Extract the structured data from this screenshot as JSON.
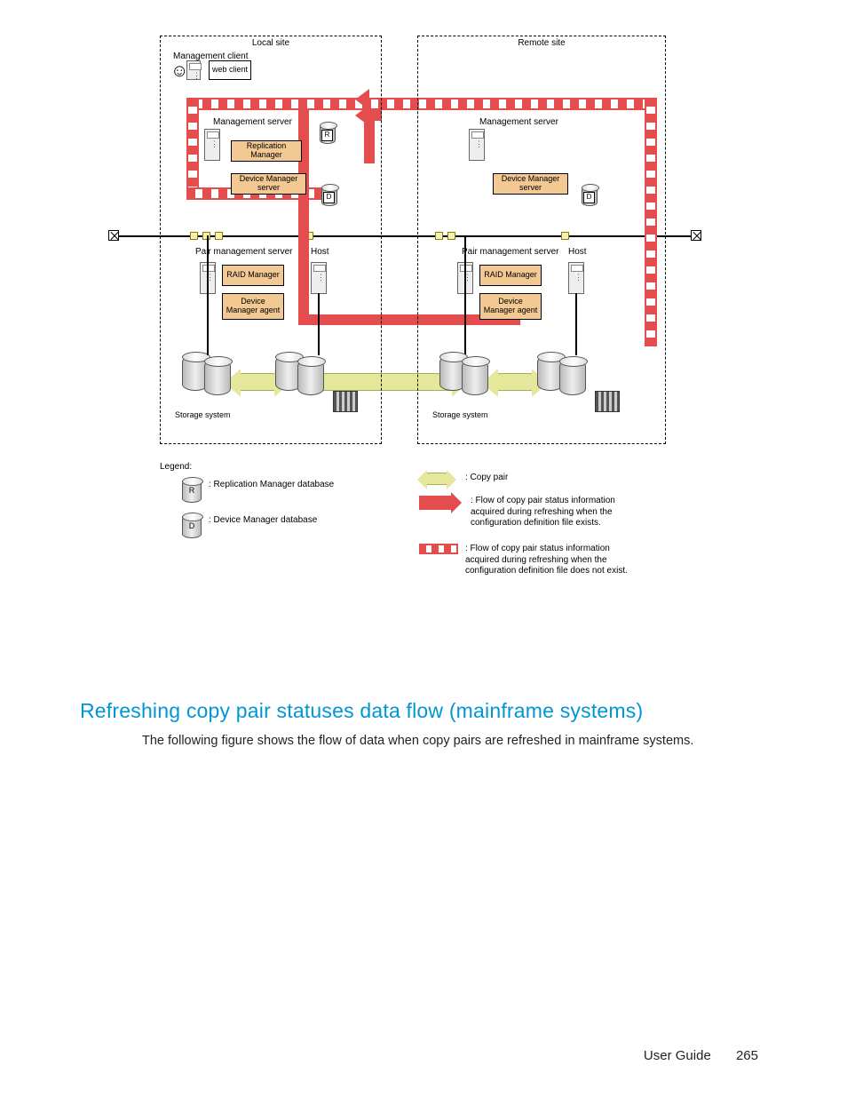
{
  "diagram": {
    "local_site_label": "Local site",
    "remote_site_label": "Remote site",
    "management_client_label": "Management client",
    "web_client_label": "web client",
    "management_server_label_local": "Management server",
    "management_server_label_remote": "Management server",
    "replication_manager_label": "Replication Manager",
    "device_manager_server_label": "Device Manager server",
    "pair_management_server_label": "Pair management server",
    "host_label": "Host",
    "raid_manager_label": "RAID Manager",
    "device_manager_agent_label": "Device Manager agent",
    "storage_system_label": "Storage system",
    "cyl_R": "R",
    "cyl_D": "D"
  },
  "legend": {
    "title": "Legend:",
    "replication_db": ": Replication Manager database",
    "device_db": ": Device Manager database",
    "copy_pair": ": Copy pair",
    "flow_solid": ": Flow of copy pair status information acquired during refreshing when the configuration definition file exists.",
    "flow_dash": ": Flow of copy pair status information acquired during refreshing when the configuration definition file does not exist."
  },
  "section": {
    "heading": "Refreshing copy pair statuses data flow (mainframe systems)",
    "body": "The following figure shows the flow of data when copy pairs are refreshed in mainframe systems."
  },
  "footer": {
    "doc_title": "User Guide",
    "page_number": "265"
  }
}
